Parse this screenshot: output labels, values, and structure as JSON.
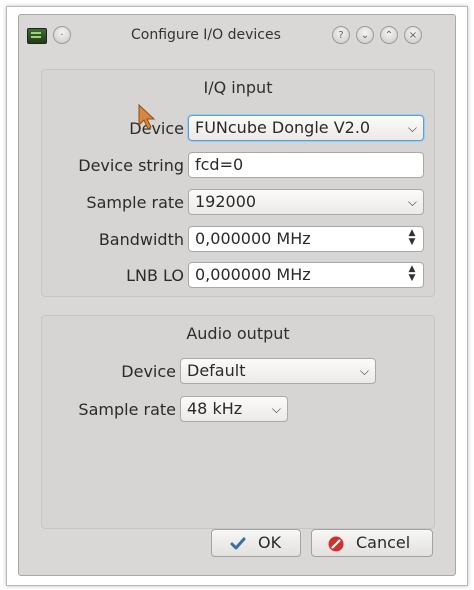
{
  "window": {
    "title": "Configure I/O devices",
    "titlebar_buttons": [
      "?",
      "⌄",
      "⌃",
      "×"
    ]
  },
  "iq_input": {
    "title": "I/Q input",
    "device_label": "Device",
    "device_value": "FUNcube Dongle V2.0",
    "device_string_label": "Device string",
    "device_string_value": "fcd=0",
    "sample_rate_label": "Sample rate",
    "sample_rate_value": "192000",
    "bandwidth_label": "Bandwidth",
    "bandwidth_value": "0,000000 MHz",
    "lnb_lo_label": "LNB LO",
    "lnb_lo_value": "0,000000 MHz"
  },
  "audio_output": {
    "title": "Audio output",
    "device_label": "Device",
    "device_value": "Default",
    "sample_rate_label": "Sample rate",
    "sample_rate_value": "48 kHz"
  },
  "buttons": {
    "ok_label": "OK",
    "cancel_label": "Cancel"
  },
  "colors": {
    "window_bg": "#d9d8d6",
    "focus_border": "#5aa0d8",
    "ok_check": "#3a6ea5",
    "cancel_red": "#d0312d",
    "cursor_orange": "#d9863e"
  }
}
